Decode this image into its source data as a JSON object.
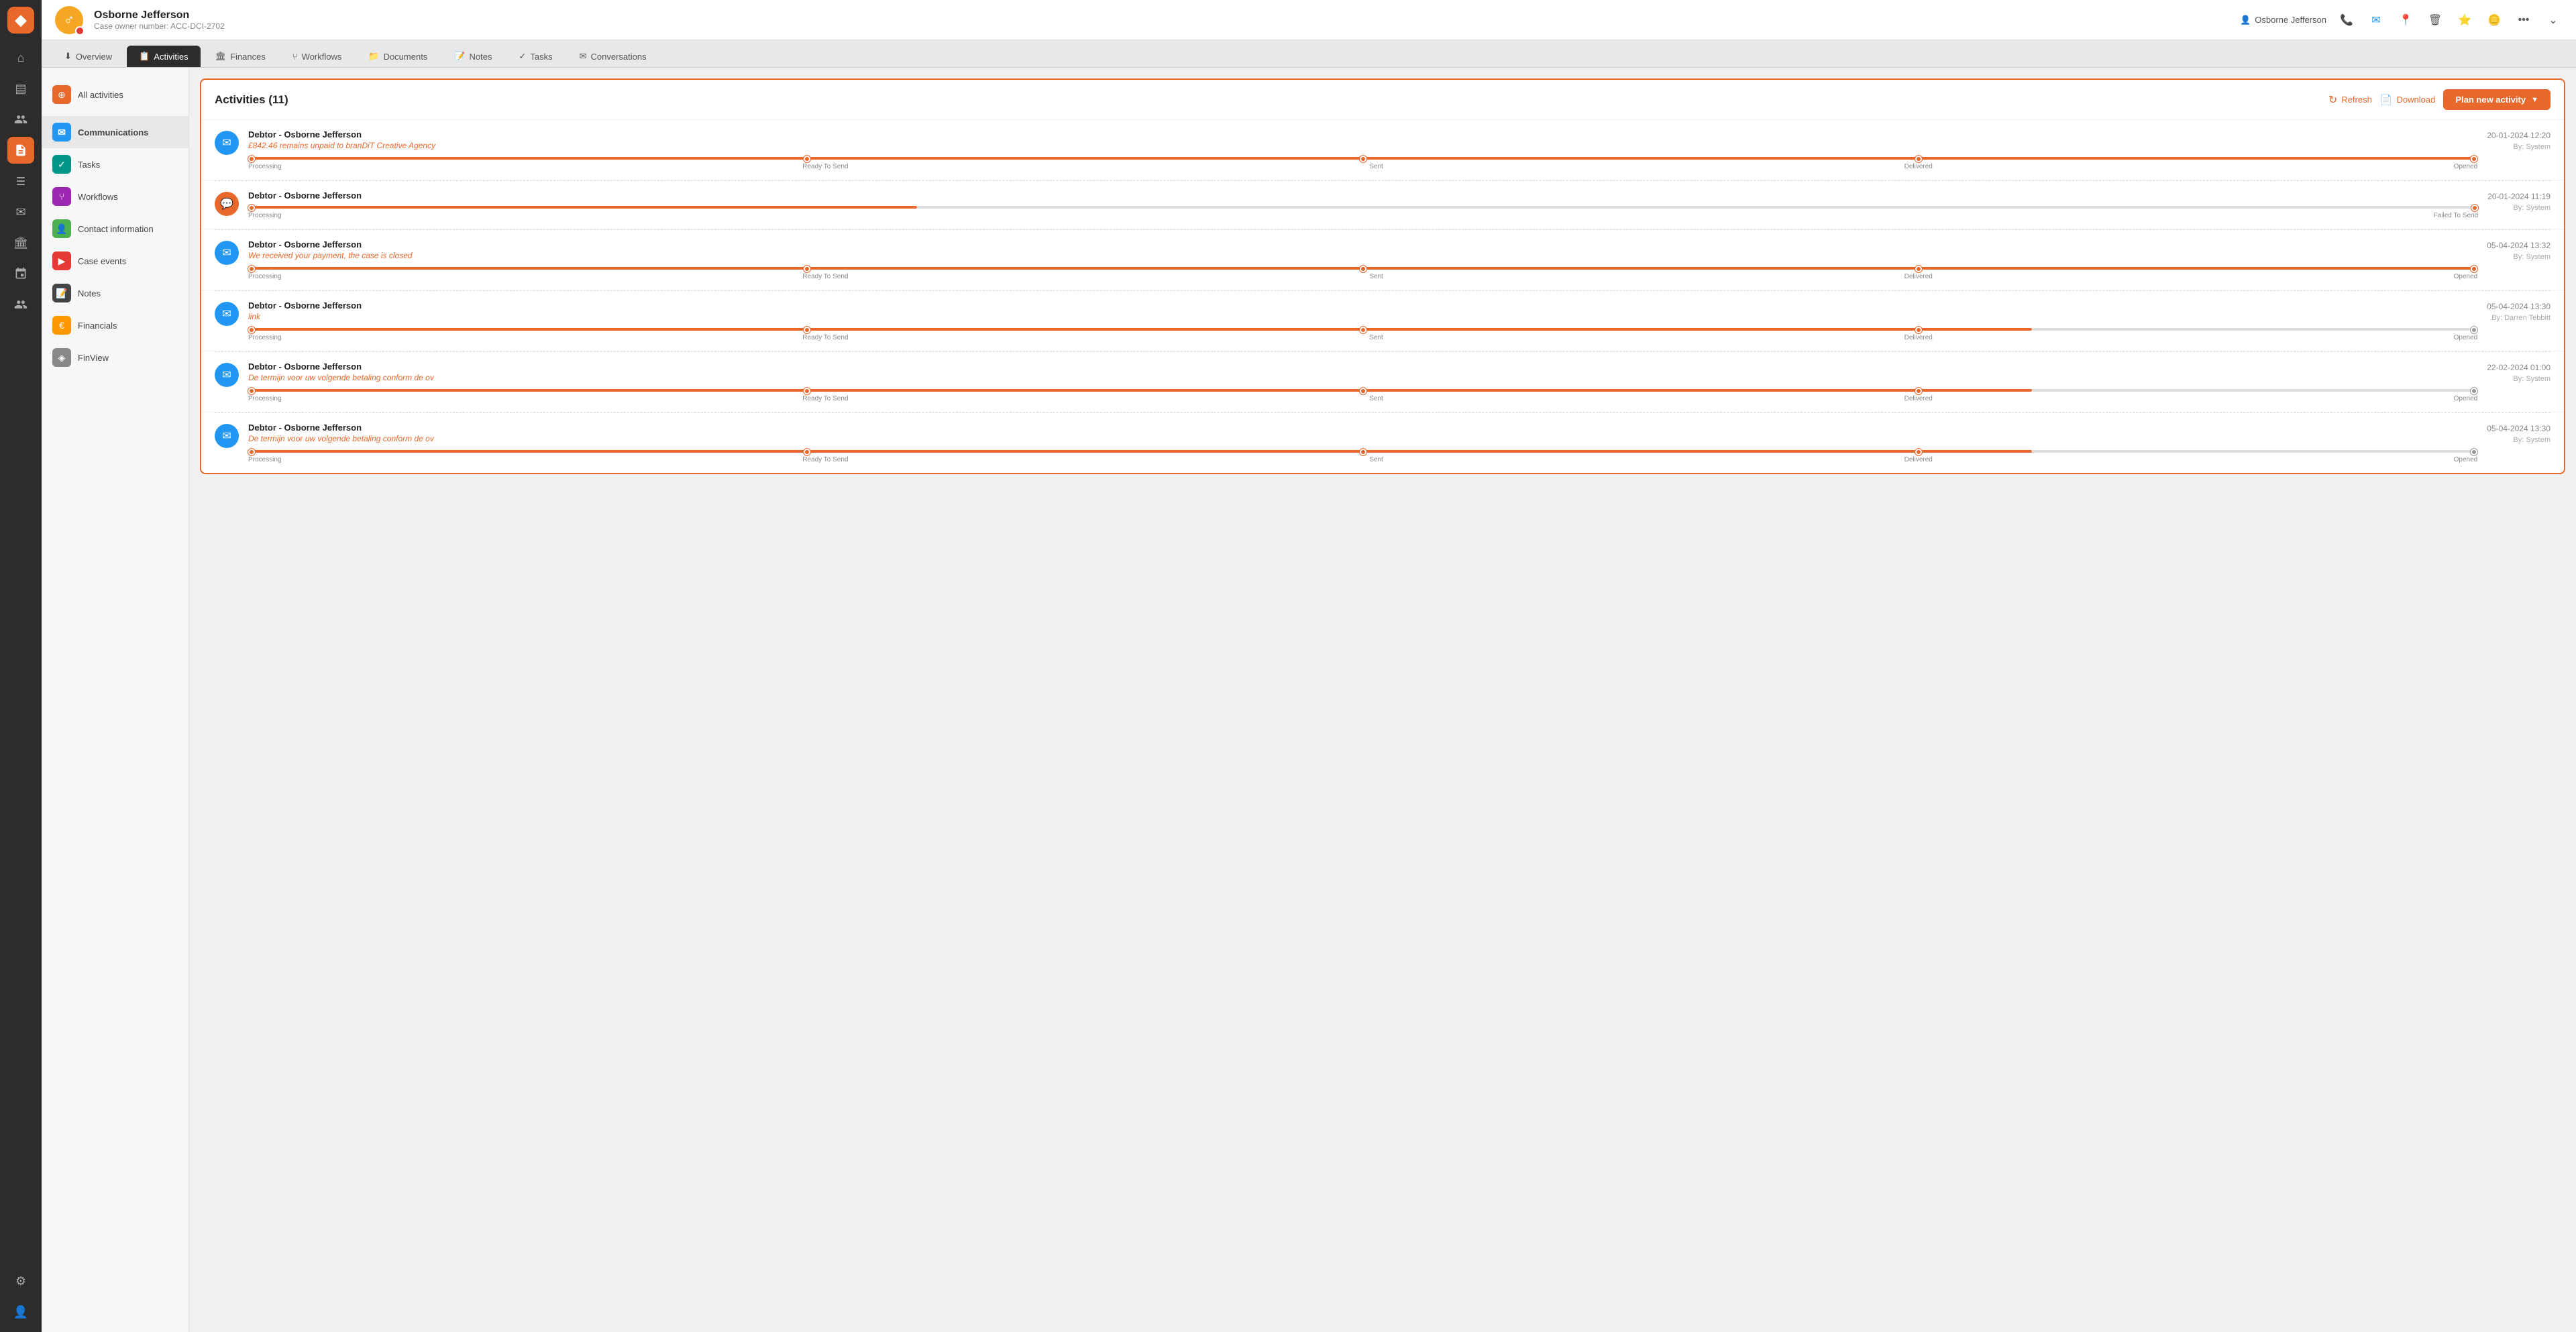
{
  "app": {
    "logo_icon": "◆"
  },
  "left_nav": {
    "icons": [
      {
        "id": "home",
        "symbol": "⌂",
        "active": false
      },
      {
        "id": "cases",
        "symbol": "▤",
        "active": false
      },
      {
        "id": "contacts",
        "symbol": "👥",
        "active": false
      },
      {
        "id": "records",
        "symbol": "📋",
        "active": true
      },
      {
        "id": "data",
        "symbol": "🗄",
        "active": false
      },
      {
        "id": "mail",
        "symbol": "✉",
        "active": false
      },
      {
        "id": "bank",
        "symbol": "🏛",
        "active": false
      },
      {
        "id": "workflows",
        "symbol": "⑂",
        "active": false
      },
      {
        "id": "team",
        "symbol": "👥",
        "active": false
      },
      {
        "id": "settings",
        "symbol": "⚙",
        "active": false
      },
      {
        "id": "user",
        "symbol": "👤",
        "active": false
      }
    ]
  },
  "top_bar": {
    "case_name": "Osborne Jefferson",
    "case_number": "Case owner number: ACC-DCI-2702",
    "user_name": "Osborne Jefferson",
    "actions": [
      "phone",
      "email",
      "location",
      "delete",
      "star",
      "more",
      "expand"
    ]
  },
  "tabs": [
    {
      "id": "overview",
      "label": "Overview",
      "active": false
    },
    {
      "id": "activities",
      "label": "Activities",
      "active": true
    },
    {
      "id": "finances",
      "label": "Finances",
      "active": false
    },
    {
      "id": "workflows",
      "label": "Workflows",
      "active": false
    },
    {
      "id": "documents",
      "label": "Documents",
      "active": false
    },
    {
      "id": "notes",
      "label": "Notes",
      "active": false
    },
    {
      "id": "tasks",
      "label": "Tasks",
      "active": false
    },
    {
      "id": "conversations",
      "label": "Conversations",
      "active": false
    }
  ],
  "sidebar": {
    "items": [
      {
        "id": "all-activities",
        "label": "All activities",
        "icon": "⊕",
        "icon_class": "icon-orange"
      },
      {
        "id": "communications",
        "label": "Communications",
        "icon": "✉",
        "icon_class": "icon-blue",
        "active": true
      },
      {
        "id": "tasks",
        "label": "Tasks",
        "icon": "✓",
        "icon_class": "icon-teal"
      },
      {
        "id": "workflows",
        "label": "Workflows",
        "icon": "⑂",
        "icon_class": "icon-purple"
      },
      {
        "id": "contact-information",
        "label": "Contact information",
        "icon": "👤",
        "icon_class": "icon-green"
      },
      {
        "id": "case-events",
        "label": "Case events",
        "icon": "▶",
        "icon_class": "icon-red"
      },
      {
        "id": "notes",
        "label": "Notes",
        "icon": "📝",
        "icon_class": "icon-dark"
      },
      {
        "id": "financials",
        "label": "Financials",
        "icon": "€",
        "icon_class": "icon-yellow"
      },
      {
        "id": "finview",
        "label": "FinView",
        "icon": "◈",
        "icon_class": "icon-gray"
      }
    ]
  },
  "activities_panel": {
    "title": "Activities (11)",
    "refresh_label": "Refresh",
    "download_label": "Download",
    "plan_label": "Plan new activity",
    "items": [
      {
        "id": 1,
        "icon_type": "blue",
        "icon_symbol": "✉",
        "title": "Debtor - Osborne Jefferson",
        "subtitle": "£842.46 remains unpaid to branDiT Creative Agency",
        "date": "20-01-2024 12:20",
        "by": "By: System",
        "progress": 5,
        "steps": [
          "Processing",
          "Ready To Send",
          "Sent",
          "Delivered",
          "Opened"
        ]
      },
      {
        "id": 2,
        "icon_type": "orange",
        "icon_symbol": "💬",
        "title": "Debtor - Osborne Jefferson",
        "subtitle": "",
        "date": "20-01-2024 11:19",
        "by": "By: System",
        "progress": 2,
        "steps": [
          "Processing",
          "Failed To Send"
        ]
      },
      {
        "id": 3,
        "icon_type": "blue",
        "icon_symbol": "✉",
        "title": "Debtor - Osborne Jefferson",
        "subtitle": "We received your payment, the case is closed",
        "date": "05-04-2024 13:32",
        "by": "By: System",
        "progress": 5,
        "steps": [
          "Processing",
          "Ready To Send",
          "Sent",
          "Delivered",
          "Opened"
        ]
      },
      {
        "id": 4,
        "icon_type": "blue",
        "icon_symbol": "✉",
        "title": "Debtor - Osborne Jefferson",
        "subtitle": "link",
        "date": "05-04-2024 13:30",
        "by": "By: Darren Tebbitt",
        "progress": 4,
        "steps": [
          "Processing",
          "Ready To Send",
          "Sent",
          "Delivered",
          "Opened"
        ]
      },
      {
        "id": 5,
        "icon_type": "blue",
        "icon_symbol": "✉",
        "title": "Debtor - Osborne Jefferson",
        "subtitle": "De termijn voor uw volgende betaling conform de ov",
        "date": "22-02-2024 01:00",
        "by": "By: System",
        "progress": 4,
        "steps": [
          "Processing",
          "Ready To Send",
          "Sent",
          "Delivered",
          "Opened"
        ]
      },
      {
        "id": 6,
        "icon_type": "blue",
        "icon_symbol": "✉",
        "title": "Debtor - Osborne Jefferson",
        "subtitle": "De termijn voor uw volgende betaling conform de ov",
        "date": "05-04-2024 13:30",
        "by": "By: System",
        "progress": 4,
        "steps": [
          "Processing",
          "Ready To Send",
          "Sent",
          "Delivered",
          "Opened"
        ]
      }
    ]
  }
}
